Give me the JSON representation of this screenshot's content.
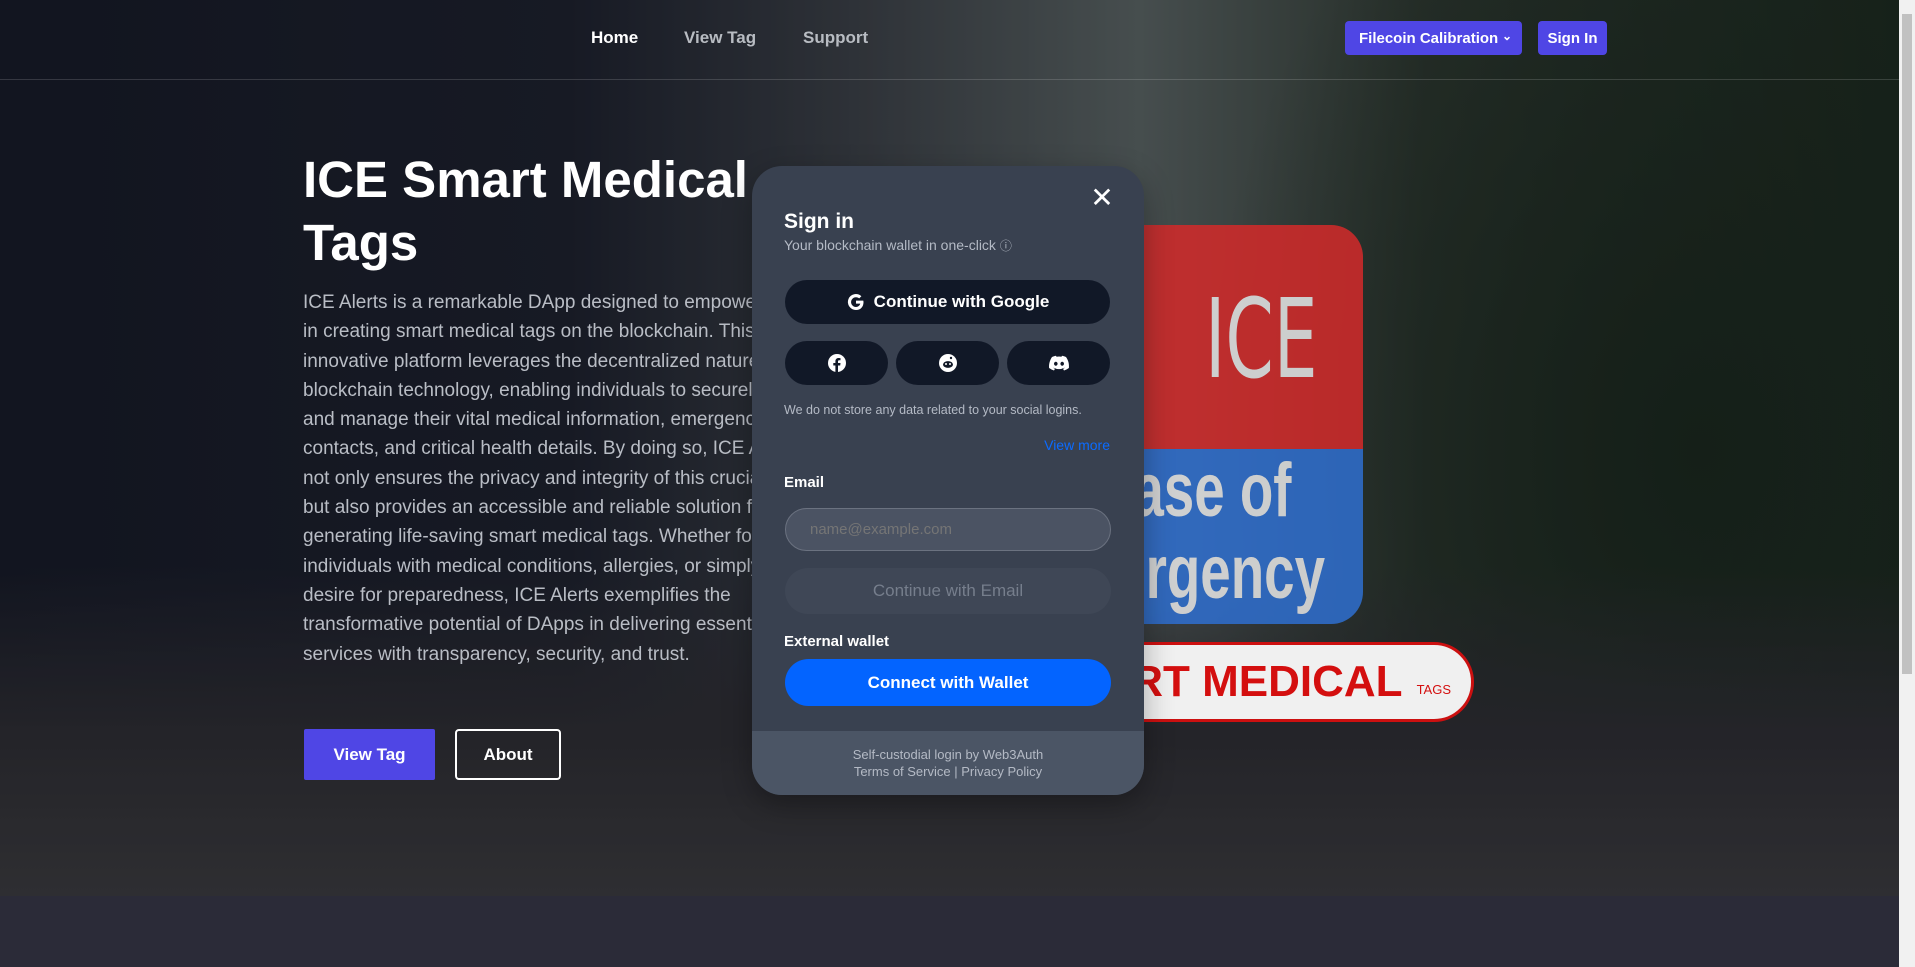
{
  "nav": {
    "items": [
      {
        "label": "Home",
        "active": true
      },
      {
        "label": "View Tag"
      },
      {
        "label": "Support"
      }
    ],
    "network_label": "Filecoin Calibration",
    "sign_in_label": "Sign In"
  },
  "hero": {
    "title": "ICE Smart Medical Tags",
    "description": "ICE Alerts is a remarkable DApp designed to empower users in creating smart medical tags on the blockchain. This innovative platform leverages the decentralized nature of blockchain technology, enabling individuals to securely store and manage their vital medical information, emergency contacts, and critical health details. By doing so, ICE Alerts not only ensures the privacy and integrity of this crucial data but also provides an accessible and reliable solution for generating life-saving smart medical tags. Whether for individuals with medical conditions, allergies, or simply a desire for preparedness, ICE Alerts exemplifies the transformative potential of DApps in delivering essential services with transparency, security, and trust.",
    "view_tag_label": "View Tag",
    "about_label": "About",
    "logo": {
      "ice": "ICE",
      "line1": "In Case of",
      "line2": "Emergency",
      "banner": "SMART MEDICAL",
      "banner_small": "TAGS"
    }
  },
  "modal": {
    "title": "Sign in",
    "subtitle": "Your blockchain wallet in one-click",
    "google_label": "Continue with Google",
    "social": [
      "facebook",
      "reddit",
      "discord"
    ],
    "note": "We do not store any data related to your social logins.",
    "view_more": "View more",
    "email_label": "Email",
    "email_placeholder": "name@example.com",
    "email_value": "",
    "email_button": "Continue with Email",
    "wallet_label": "External wallet",
    "wallet_button": "Connect with Wallet",
    "footer_line1": "Self-custodial login by Web3Auth",
    "terms": "Terms of Service",
    "separator": "|",
    "privacy": "Privacy Policy"
  },
  "colors": {
    "accent": "#4f46e5",
    "wallet_blue": "#0364ff",
    "modal_bg": "#394150"
  }
}
